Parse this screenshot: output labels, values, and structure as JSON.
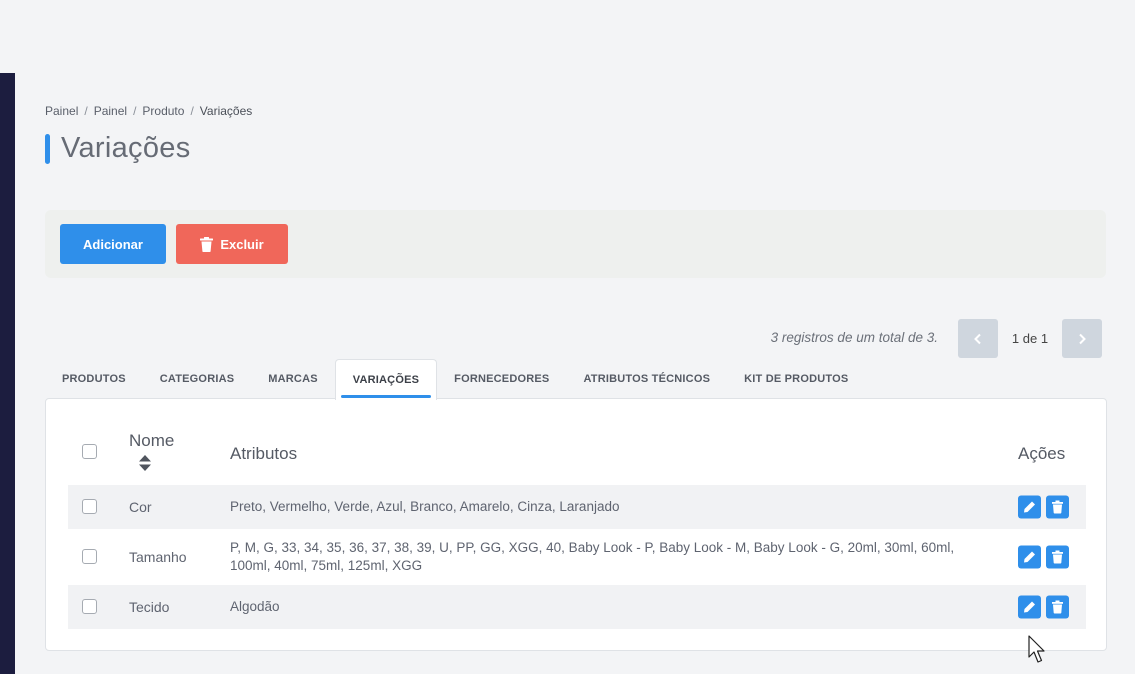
{
  "breadcrumb": {
    "items": [
      "Painel",
      "Painel",
      "Produto"
    ],
    "current": "Variações",
    "separator": "/"
  },
  "page": {
    "title": "Variações"
  },
  "actions": {
    "add_label": "Adicionar",
    "delete_label": "Excluir",
    "delete_icon": "trash-icon"
  },
  "pagination": {
    "info": "3 registros de um total de 3.",
    "pages": "1 de 1",
    "prev_icon": "chevron-left-icon",
    "next_icon": "chevron-right-icon"
  },
  "tabs": [
    {
      "label": "PRODUTOS",
      "active": false
    },
    {
      "label": "CATEGORIAS",
      "active": false
    },
    {
      "label": "MARCAS",
      "active": false
    },
    {
      "label": "VARIAÇÕES",
      "active": true
    },
    {
      "label": "FORNECEDORES",
      "active": false
    },
    {
      "label": "ATRIBUTOS TÉCNICOS",
      "active": false
    },
    {
      "label": "KIT DE PRODUTOS",
      "active": false
    }
  ],
  "table": {
    "headers": {
      "name": "Nome",
      "attributes": "Atributos",
      "actions": "Ações"
    },
    "rows": [
      {
        "name": "Cor",
        "attributes": "Preto, Vermelho, Verde, Azul, Branco, Amarelo, Cinza, Laranjado"
      },
      {
        "name": "Tamanho",
        "attributes": "P, M, G, 33, 34, 35, 36, 37, 38, 39, U, PP, GG, XGG, 40, Baby Look - P, Baby Look - M, Baby Look - G, 20ml, 30ml, 60ml, 100ml, 40ml, 75ml, 125ml, XGG"
      },
      {
        "name": "Tecido",
        "attributes": "Algodão"
      }
    ],
    "row_action_icons": [
      "pencil-icon",
      "trash-icon"
    ]
  },
  "colors": {
    "primary": "#2f8fea",
    "danger": "#f0675a",
    "sidebar": "#1c1d3f",
    "background": "#f3f4f6"
  }
}
